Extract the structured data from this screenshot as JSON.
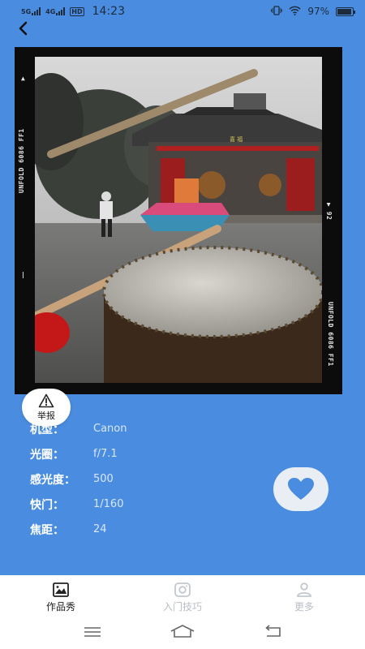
{
  "status_bar": {
    "signal1": "5G",
    "signal2": "4G",
    "hd": "HD",
    "time": "14:23",
    "battery": "97%",
    "battery_level": 0.97
  },
  "photo": {
    "film_left": "UNFOLD 6086 FF1",
    "film_right": "UNFOLD 6086 FF1",
    "frame_number": "92",
    "sign_text": "喜 福"
  },
  "report": {
    "label": "举报"
  },
  "info": [
    {
      "label": "机型：",
      "value": "Canon"
    },
    {
      "label": "光圈：",
      "value": "f/7.1"
    },
    {
      "label": "感光度：",
      "value": "500"
    },
    {
      "label": "快门：",
      "value": "1/160"
    },
    {
      "label": "焦距：",
      "value": "24"
    }
  ],
  "tabs": [
    {
      "label": "作品秀",
      "icon": "image-icon",
      "active": true
    },
    {
      "label": "入门技巧",
      "icon": "camera-icon",
      "active": false
    },
    {
      "label": "更多",
      "icon": "person-icon",
      "active": false
    }
  ],
  "colors": {
    "background": "#4a8de0",
    "like_heart": "#4a8de0",
    "tab_active": "#222222",
    "tab_inactive": "#b9bec6"
  }
}
